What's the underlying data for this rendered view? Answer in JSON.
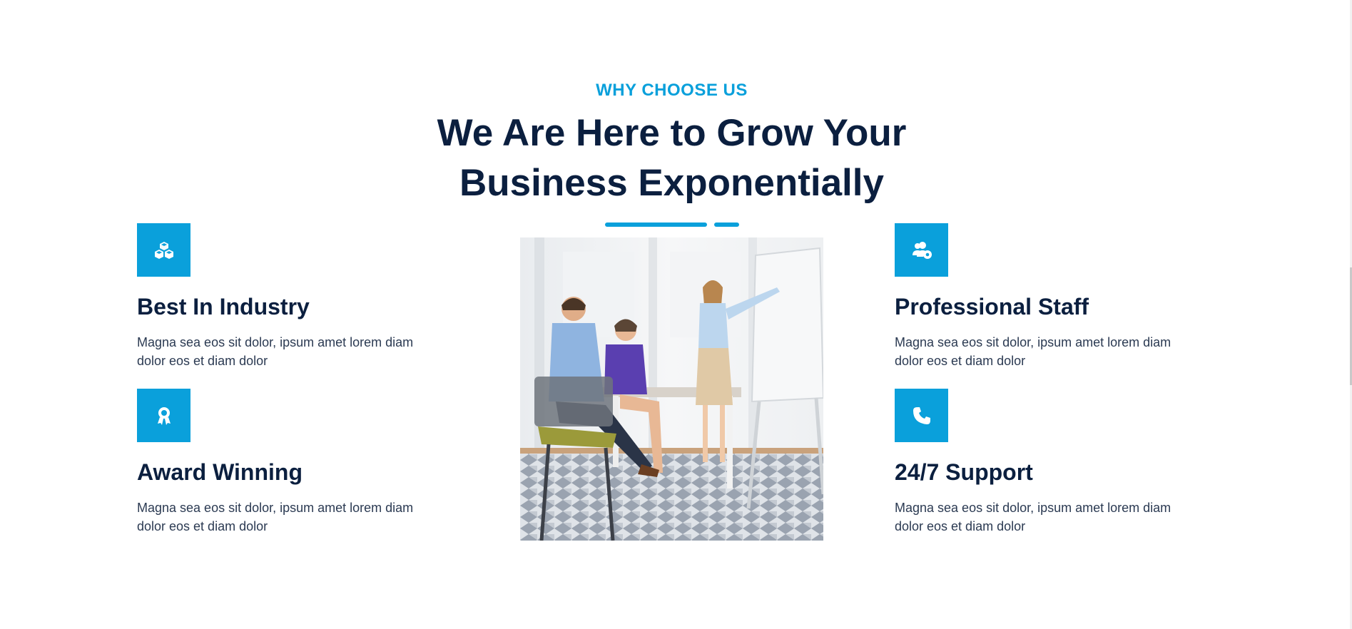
{
  "section": {
    "kicker": "WHY CHOOSE US",
    "headline": "We Are Here to Grow Your Business Exponentially"
  },
  "features": [
    {
      "title": "Best In Industry",
      "description": "Magna sea eos sit dolor, ipsum amet lorem diam dolor eos et diam dolor",
      "icon": "cubes-icon"
    },
    {
      "title": "Award Winning",
      "description": "Magna sea eos sit dolor, ipsum amet lorem diam dolor eos et diam dolor",
      "icon": "award-icon"
    },
    {
      "title": "Professional Staff",
      "description": "Magna sea eos sit dolor, ipsum amet lorem diam dolor eos et diam dolor",
      "icon": "users-cog-icon"
    },
    {
      "title": "24/7 Support",
      "description": "Magna sea eos sit dolor, ipsum amet lorem diam dolor eos et diam dolor",
      "icon": "phone-icon"
    }
  ],
  "image": {
    "subject": "office-meeting-photo"
  },
  "colors": {
    "accent": "#0aa0db",
    "heading": "#0b1f3f",
    "body_text": "#2b3a52",
    "background": "#ffffff"
  }
}
